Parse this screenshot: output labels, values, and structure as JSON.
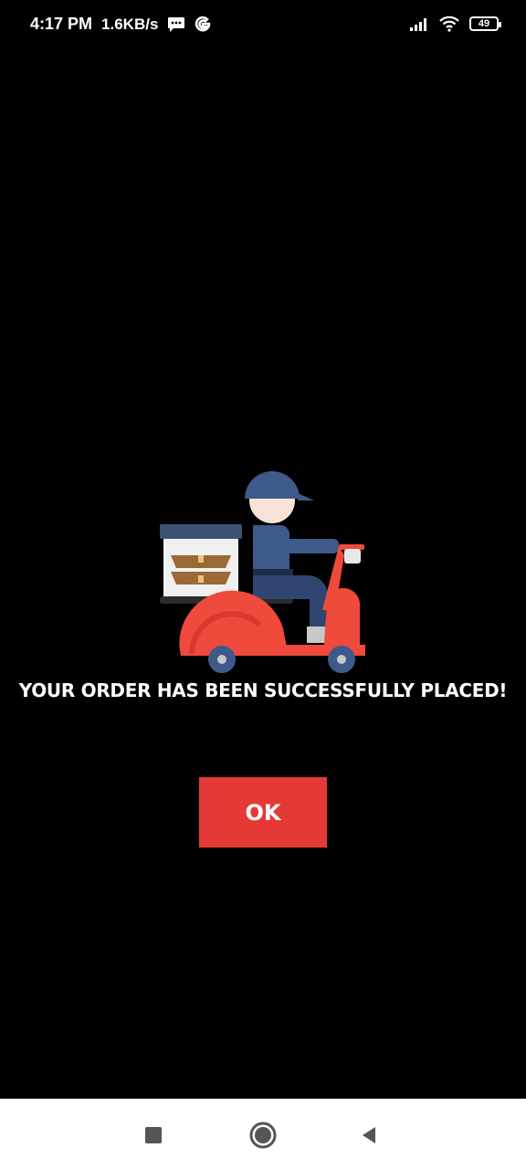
{
  "status_bar": {
    "time": "4:17 PM",
    "net_speed": "1.6KB/s",
    "battery_level": "49",
    "icons": [
      "message-icon",
      "google-icon",
      "signal-icon",
      "wifi-icon",
      "battery-icon"
    ]
  },
  "main": {
    "illustration": "delivery-scooter-illustration",
    "message": "YOUR ORDER HAS BEEN SUCCESSFULLY PLACED!",
    "ok_label": "OK"
  },
  "nav_bar": {
    "icons": [
      "recent-apps-icon",
      "home-icon",
      "back-icon"
    ]
  },
  "colors": {
    "background": "#000000",
    "button": "#e53935",
    "scooter_red": "#ef4a3c",
    "rider_blue": "#3d5a8a",
    "nav_background": "#ffffff"
  }
}
